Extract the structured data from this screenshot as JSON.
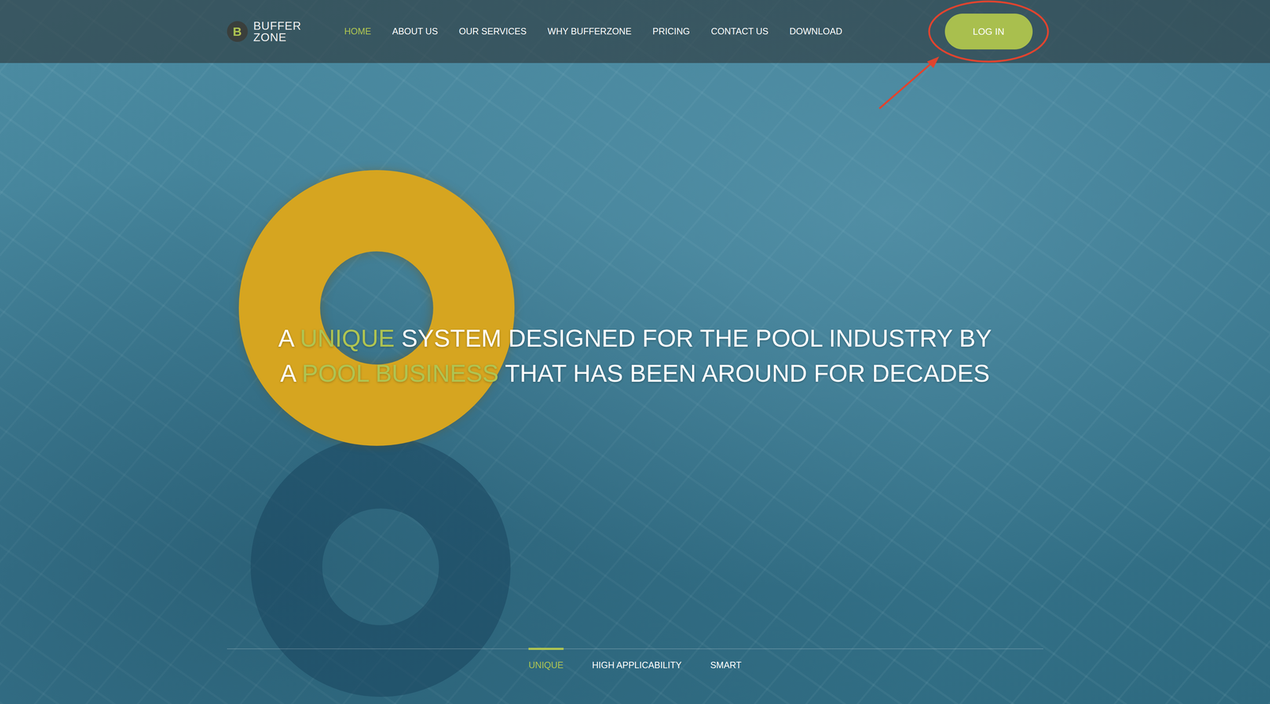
{
  "logo": {
    "mark": "B",
    "line1": "BUFFER",
    "line2": "ZONE"
  },
  "nav": [
    {
      "label": "HOME",
      "selected": true
    },
    {
      "label": "ABOUT US",
      "selected": false
    },
    {
      "label": "OUR SERVICES",
      "selected": false
    },
    {
      "label": "WHY BUFFERZONE",
      "selected": false
    },
    {
      "label": "PRICING",
      "selected": false
    },
    {
      "label": "CONTACT US",
      "selected": false
    },
    {
      "label": "DOWNLOAD",
      "selected": false
    }
  ],
  "login": {
    "label": "LOG IN",
    "highlighted": true
  },
  "headline": {
    "lines": [
      [
        {
          "text": "A ",
          "highlight": false
        },
        {
          "text": "UNIQUE",
          "highlight": true
        },
        {
          "text": " SYSTEM DESIGNED FOR THE POOL INDUSTRY BY",
          "highlight": false
        }
      ],
      [
        {
          "text": "A ",
          "highlight": false
        },
        {
          "text": "POOL BUSINESS",
          "highlight": true
        },
        {
          "text": " THAT HAS BEEN AROUND FOR DECADES",
          "highlight": false
        }
      ]
    ]
  },
  "tabs": [
    {
      "label": "UNIQUE",
      "selected": true
    },
    {
      "label": "HIGH APPLICABILITY",
      "selected": false
    },
    {
      "label": "SMART",
      "selected": false
    }
  ]
}
